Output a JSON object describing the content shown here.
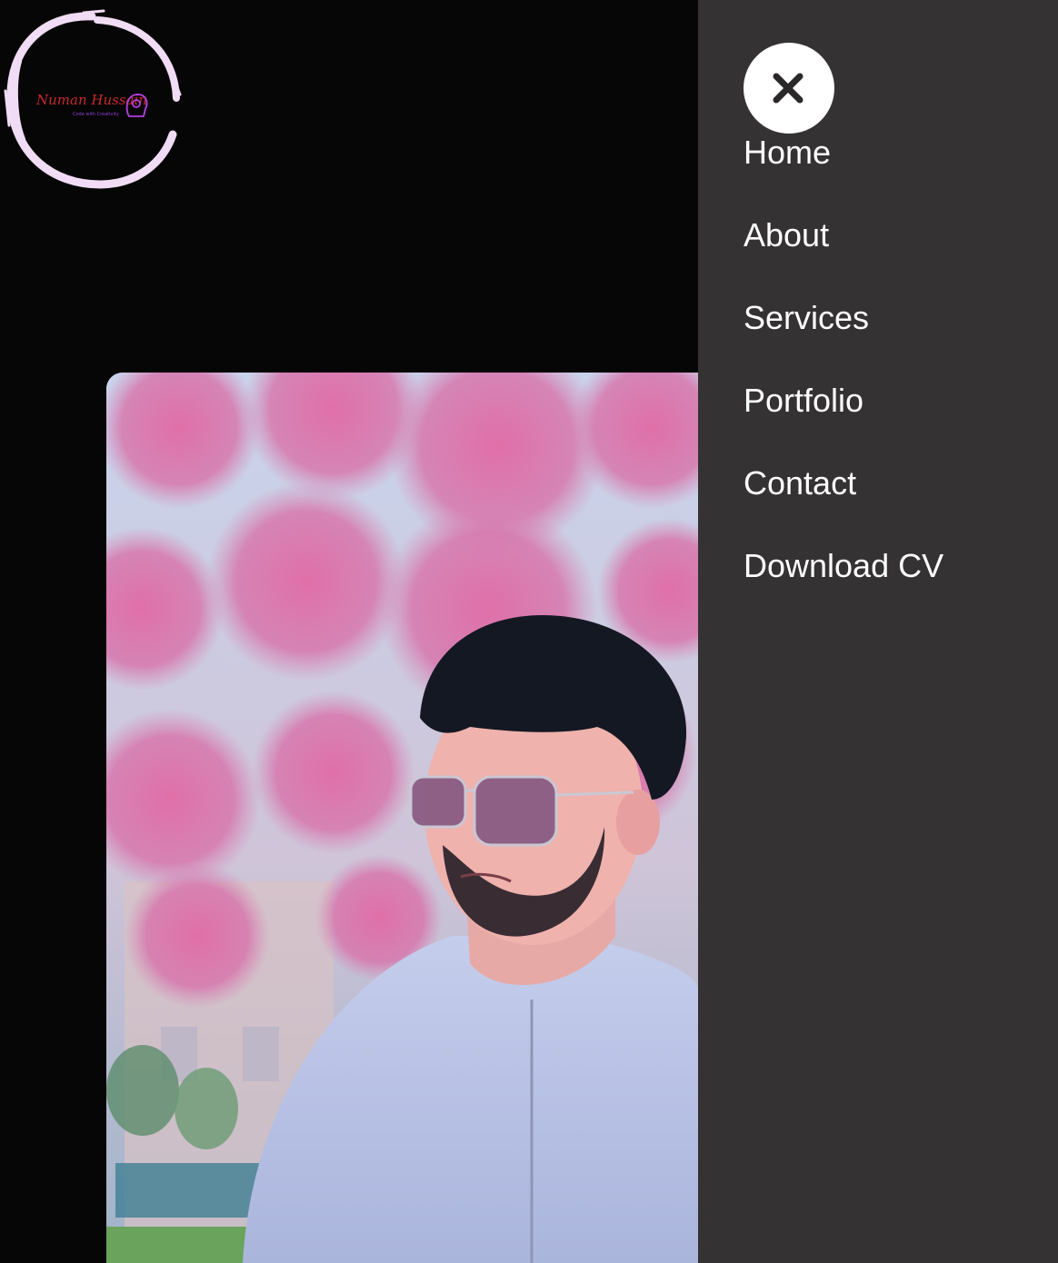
{
  "logo": {
    "name": "Numan Hussain",
    "tagline": "Code with Creativity",
    "icon": "lightbulb-head-icon",
    "ring_color": "#f1dcf5"
  },
  "hero": {
    "photo": "portrait-photo"
  },
  "nav": {
    "close_icon": "close-icon",
    "items": [
      {
        "label": "Home"
      },
      {
        "label": "About"
      },
      {
        "label": "Services"
      },
      {
        "label": "Portfolio"
      },
      {
        "label": "Contact"
      },
      {
        "label": "Download CV"
      }
    ]
  },
  "colors": {
    "background": "#070607",
    "sidebar": "#353234",
    "nav_text": "#ffffff"
  }
}
